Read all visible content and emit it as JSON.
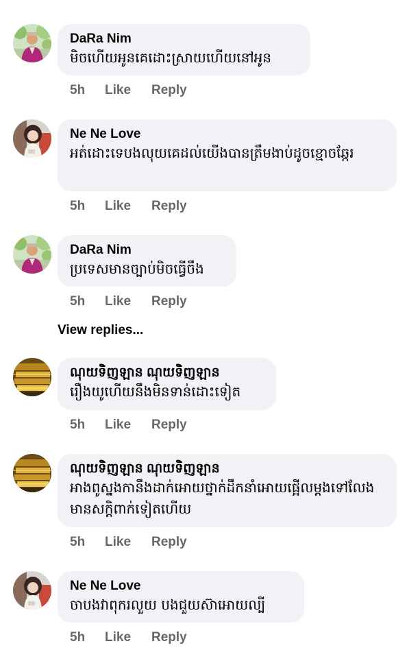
{
  "comments": [
    {
      "author": "DaRa Nim",
      "text": "មិចហើយអូនគេដោះស្រាយហើយនៅអូន",
      "time": "5h",
      "like_label": "Like",
      "reply_label": "Reply",
      "avatar_icon": "profile-photo-man-icon"
    },
    {
      "author": "Ne Ne Love",
      "text": "អត់ដោះទេបងលុយគេដល់យើងបានត្រឹមងាប់ដូចខ្មោចឆ្កែរ",
      "time": "5h",
      "like_label": "Like",
      "reply_label": "Reply",
      "avatar_icon": "profile-photo-woman-icon"
    },
    {
      "author": "DaRa Nim",
      "text": "ប្រទេសមានច្បាប់មិចធ្វើចឹង",
      "time": "5h",
      "like_label": "Like",
      "reply_label": "Reply",
      "avatar_icon": "profile-photo-man-icon"
    },
    {
      "author": "ណុយទិញឡាន ណុយទិញឡាន",
      "text": "រឿងយូហើយនឹងមិនទាន់ដោះទៀត",
      "time": "5h",
      "like_label": "Like",
      "reply_label": "Reply",
      "avatar_icon": "profile-photo-gold-icon"
    },
    {
      "author": "ណុយទិញឡាន ណុយទិញឡាន",
      "text": "អាងពូស្នងកានឹងដាក់អោយថ្នាក់ដឹកនាំអោយផ្អើលម្តងទៅលែងមានសក្តិពាក់ទៀតហើយ",
      "time": "5h",
      "like_label": "Like",
      "reply_label": "Reply",
      "avatar_icon": "profile-photo-gold-icon"
    },
    {
      "author": "Ne Ne Love",
      "text": "ចាបងវាពុករលួយ បងជួយស៊ាអោយល្បី",
      "time": "5h",
      "like_label": "Like",
      "reply_label": "Reply",
      "avatar_icon": "profile-photo-woman-icon"
    }
  ],
  "view_replies_label": "View replies...",
  "colors": {
    "bubble_bg": "#f0f2f5",
    "text": "#050505",
    "secondary_text": "#65676b"
  }
}
